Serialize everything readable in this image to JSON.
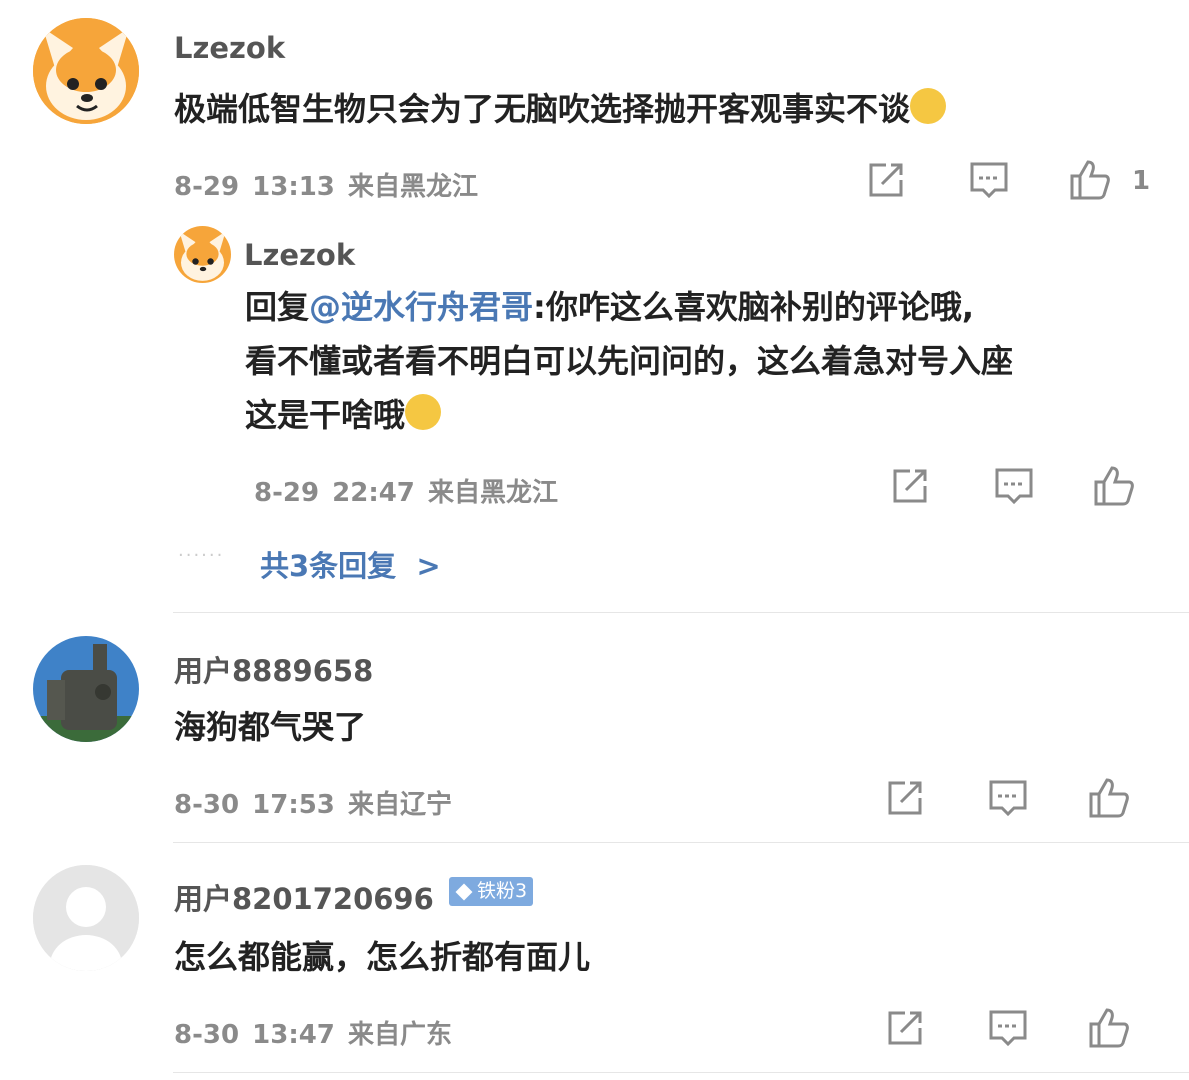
{
  "comments": [
    {
      "username": "Lzezok",
      "text": "极端低智生物只会为了无脑吹选择抛开客观事实不谈",
      "date": "8-29",
      "time": "13:13",
      "location": "来自黑龙江",
      "likes": "1",
      "reply": {
        "username": "Lzezok",
        "prefix": "回复",
        "mention": "@逆水行舟君哥",
        "line1": ":你咋这么喜欢脑补别的评论哦,",
        "line2": "看不懂或者看不明白可以先问问的，这么着急对号入座",
        "line3": "这是干啥哦",
        "date": "8-29",
        "time": "22:47",
        "location": "来自黑龙江"
      },
      "more_replies": "共3条回复",
      "more_arrow": ">",
      "dots": "......"
    },
    {
      "username": "用户8889658",
      "text": "海狗都气哭了",
      "date": "8-30",
      "time": "17:53",
      "location": "来自辽宁"
    },
    {
      "username": "用户8201720696",
      "badge": "铁粉3",
      "text": "怎么都能赢，怎么折都有面儿",
      "date": "8-30",
      "time": "13:47",
      "location": "来自广东"
    }
  ],
  "colors": {
    "mention": "#4a78b4",
    "meta": "#8a8a8a",
    "badge": "#7eaadf"
  },
  "icons": [
    "share-icon",
    "comment-icon",
    "like-icon"
  ]
}
